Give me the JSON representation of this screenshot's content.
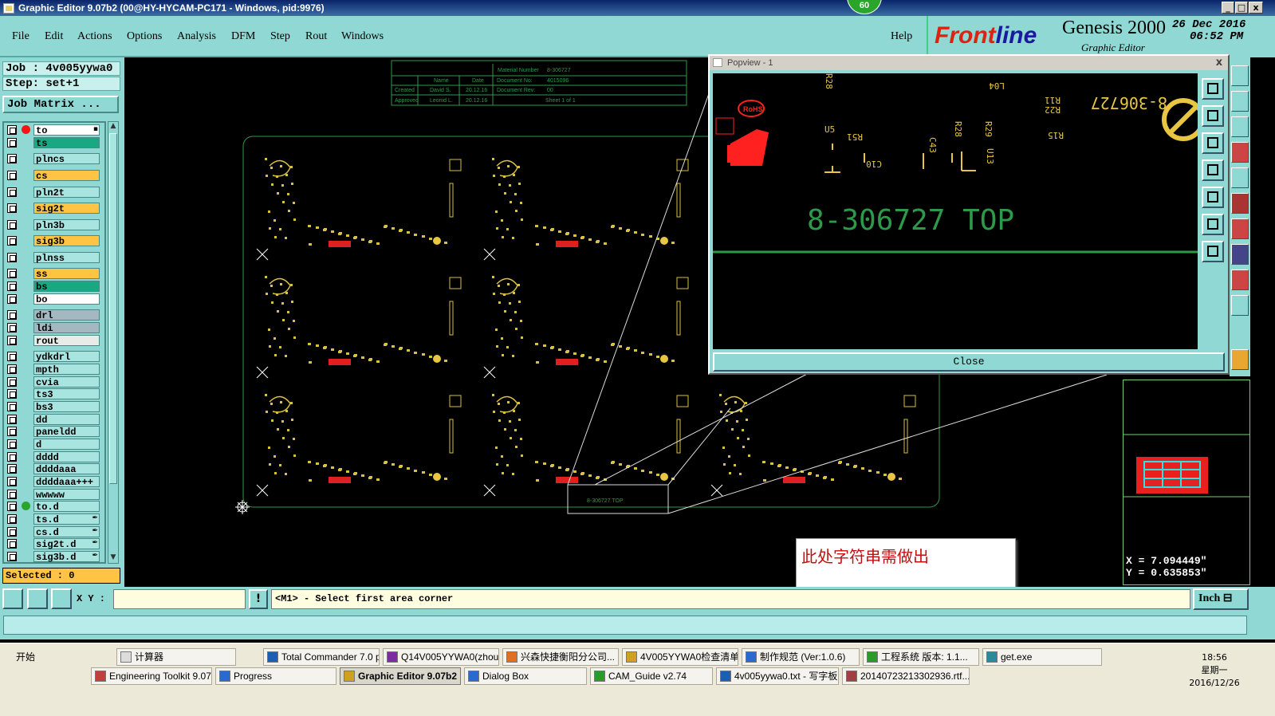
{
  "window": {
    "title": "Graphic Editor 9.07b2 (00@HY-HYCAM-PC171 - Windows, pid:9976)",
    "badge": "60",
    "minimize": "_",
    "maximize": "□",
    "close": "x"
  },
  "menu": {
    "items": [
      "File",
      "Edit",
      "Actions",
      "Options",
      "Analysis",
      "DFM",
      "Step",
      "Rout",
      "Windows"
    ],
    "help": "Help"
  },
  "brand": {
    "logo_a": "Front",
    "logo_b": "line",
    "product": "Genesis 2000",
    "subtitle": "Graphic Editor",
    "date": "26 Dec 2016",
    "time": "06:52 PM"
  },
  "left": {
    "job": "Job : 4v005yywa0",
    "step": "Step: set+1",
    "job_matrix": "Job Matrix ...",
    "selected": "Selected : 0",
    "layers": [
      {
        "name": "to",
        "color": "#ffffff",
        "marker": "#ff1111",
        "tag": "▪"
      },
      {
        "name": "ts",
        "color": "#1aa882",
        "marker": "",
        "tag": ""
      },
      {
        "name": "plncs",
        "color": "#a8e4e0",
        "marker": "",
        "tag": ""
      },
      {
        "name": "cs",
        "color": "#ffc444",
        "marker": "",
        "tag": ""
      },
      {
        "name": "pln2t",
        "color": "#a8e4e0",
        "marker": "",
        "tag": ""
      },
      {
        "name": "sig2t",
        "color": "#ffc444",
        "marker": "",
        "tag": ""
      },
      {
        "name": "pln3b",
        "color": "#a8e4e0",
        "marker": "",
        "tag": ""
      },
      {
        "name": "sig3b",
        "color": "#ffc444",
        "marker": "",
        "tag": ""
      },
      {
        "name": "plnss",
        "color": "#a8e4e0",
        "marker": "",
        "tag": ""
      },
      {
        "name": "ss",
        "color": "#ffc444",
        "marker": "",
        "tag": ""
      },
      {
        "name": "bs",
        "color": "#1aa882",
        "marker": "",
        "tag": ""
      },
      {
        "name": "bo",
        "color": "#ffffff",
        "marker": "",
        "tag": ""
      },
      {
        "name": "drl",
        "color": "#a3b8c0",
        "marker": "",
        "tag": ""
      },
      {
        "name": "ldi",
        "color": "#a3b8c0",
        "marker": "",
        "tag": ""
      },
      {
        "name": "rout",
        "color": "#e8ece8",
        "marker": "",
        "tag": ""
      },
      {
        "name": "ydkdrl",
        "color": "#a8e4e0",
        "marker": "",
        "tag": ""
      },
      {
        "name": "mpth",
        "color": "#a8e4e0",
        "marker": "",
        "tag": ""
      },
      {
        "name": "cvia",
        "color": "#a8e4e0",
        "marker": "",
        "tag": ""
      },
      {
        "name": "ts3",
        "color": "#a8e4e0",
        "marker": "",
        "tag": ""
      },
      {
        "name": "bs3",
        "color": "#a8e4e0",
        "marker": "",
        "tag": ""
      },
      {
        "name": "dd",
        "color": "#a8e4e0",
        "marker": "",
        "tag": ""
      },
      {
        "name": "paneldd",
        "color": "#a8e4e0",
        "marker": "",
        "tag": ""
      },
      {
        "name": "d",
        "color": "#a8e4e0",
        "marker": "",
        "tag": ""
      },
      {
        "name": "dddd",
        "color": "#a8e4e0",
        "marker": "",
        "tag": ""
      },
      {
        "name": "ddddaaa",
        "color": "#a8e4e0",
        "marker": "",
        "tag": ""
      },
      {
        "name": "ddddaaa+++",
        "color": "#a8e4e0",
        "marker": "",
        "tag": ""
      },
      {
        "name": "wwwww",
        "color": "#a8e4e0",
        "marker": "",
        "tag": ""
      },
      {
        "name": "to.d",
        "color": "#a8e4e0",
        "marker": "#2aa52a",
        "tag": ""
      },
      {
        "name": "ts.d",
        "color": "#a8e4e0",
        "marker": "",
        "tag": "✒"
      },
      {
        "name": "cs.d",
        "color": "#a8e4e0",
        "marker": "",
        "tag": "✒"
      },
      {
        "name": "sig2t.d",
        "color": "#a8e4e0",
        "marker": "",
        "tag": "✒"
      },
      {
        "name": "sig3b.d",
        "color": "#a8e4e0",
        "marker": "",
        "tag": "✒"
      }
    ]
  },
  "canvas": {
    "titleblock": {
      "material_label": "Material Number",
      "material_value": "8-306727",
      "col_name": "Name",
      "col_date": "Date",
      "doc_no_label": "Document No:",
      "doc_no_value": "4015096",
      "doc_rev_label": "Document Rev:",
      "doc_rev_value": "00",
      "created_label": "Created",
      "created_name": "David S.",
      "created_date": "20.12.16",
      "approved_label": "Approved",
      "approved_name": "Leonid L.",
      "approved_date": "20.12.16",
      "sheet": "Sheet 1 of 1"
    },
    "zoom_label": "8-306727 TOP"
  },
  "popview": {
    "title": "Popview - 1",
    "close_x": "x",
    "big_text": "8-306727 TOP",
    "part_no": "8-306727",
    "rohs": "RoHS",
    "refdes": [
      "U5",
      "R51",
      "C10",
      "C43",
      "R28",
      "R29",
      "U13",
      "R15",
      "R11",
      "R22",
      "L04",
      "R28"
    ],
    "close_button": "Close"
  },
  "coords": {
    "x": "X = 7.094449\"",
    "y": "Y = 0.635853\""
  },
  "annotation": "此处字符串需做出",
  "command": {
    "xy_label": "X Y :",
    "xy_value": "",
    "prompt": "<M1> - Select first area corner",
    "unit": "Inch ⊟"
  },
  "taskbar": {
    "start": "开始",
    "row1": [
      "计算器",
      "Total Commander 7.0 p...",
      "Q14V005YYWA0(zhoub...",
      "兴森快捷衡阳分公司...",
      "4V005YYWA0检查清单",
      "制作规范 (Ver:1.0.6)",
      "工程系统 版本: 1.1...",
      "get.exe"
    ],
    "row2": [
      "Engineering Toolkit 9.07...",
      "Progress",
      "Graphic Editor 9.07b2 ...",
      "Dialog Box",
      "CAM_Guide v2.74",
      "4v005yywa0.txt - 写字板",
      "20140723213302936.rtf..."
    ],
    "clock_time": "18:56",
    "clock_day": "星期一",
    "clock_date": "2016/12/26"
  }
}
